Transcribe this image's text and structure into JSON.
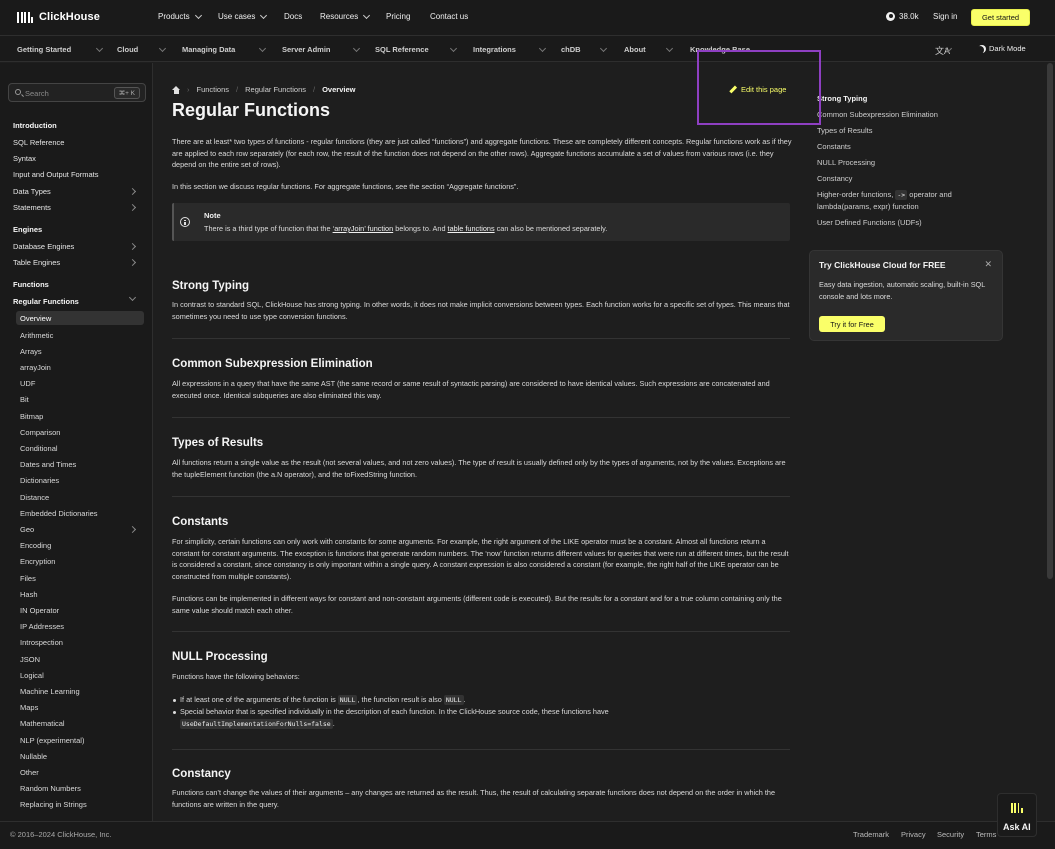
{
  "brand": {
    "name": "ClickHouse"
  },
  "topnav": {
    "items": [
      {
        "label": "Products",
        "dropdown": true
      },
      {
        "label": "Use cases",
        "dropdown": true
      },
      {
        "label": "Docs",
        "dropdown": false
      },
      {
        "label": "Resources",
        "dropdown": true
      },
      {
        "label": "Pricing",
        "dropdown": false
      },
      {
        "label": "Contact us",
        "dropdown": false
      }
    ],
    "github_stars": "38.0k",
    "signin": "Sign in",
    "get_started": "Get started"
  },
  "secnav": {
    "items": [
      "Getting Started",
      "Cloud",
      "Managing Data",
      "Server Admin",
      "SQL Reference",
      "Integrations",
      "chDB",
      "About",
      "Knowledge Base"
    ],
    "lang_icon": "文A",
    "dark_mode": "Dark Mode"
  },
  "sidebar": {
    "search_placeholder": "Search",
    "search_shortcut": "⌘+ K",
    "items": [
      {
        "label": "Introduction",
        "type": "head"
      },
      {
        "label": "SQL Reference",
        "type": "item"
      },
      {
        "label": "Syntax",
        "type": "item"
      },
      {
        "label": "Input and Output Formats",
        "type": "item"
      },
      {
        "label": "Data Types",
        "type": "item",
        "chevron": true
      },
      {
        "label": "Statements",
        "type": "item",
        "chevron": true
      },
      {
        "label": "Engines",
        "type": "head"
      },
      {
        "label": "Database Engines",
        "type": "item",
        "chevron": true
      },
      {
        "label": "Table Engines",
        "type": "item",
        "chevron": true
      },
      {
        "label": "Functions",
        "type": "head"
      },
      {
        "label": "Regular Functions",
        "type": "head",
        "expanded": true
      },
      {
        "label": "Overview",
        "type": "sub",
        "active": true
      },
      {
        "label": "Arithmetic",
        "type": "sub"
      },
      {
        "label": "Arrays",
        "type": "sub"
      },
      {
        "label": "arrayJoin",
        "type": "sub"
      },
      {
        "label": "UDF",
        "type": "sub"
      },
      {
        "label": "Bit",
        "type": "sub"
      },
      {
        "label": "Bitmap",
        "type": "sub"
      },
      {
        "label": "Comparison",
        "type": "sub"
      },
      {
        "label": "Conditional",
        "type": "sub"
      },
      {
        "label": "Dates and Times",
        "type": "sub"
      },
      {
        "label": "Dictionaries",
        "type": "sub"
      },
      {
        "label": "Distance",
        "type": "sub"
      },
      {
        "label": "Embedded Dictionaries",
        "type": "sub"
      },
      {
        "label": "Geo",
        "type": "sub",
        "chevron": true
      },
      {
        "label": "Encoding",
        "type": "sub"
      },
      {
        "label": "Encryption",
        "type": "sub"
      },
      {
        "label": "Files",
        "type": "sub"
      },
      {
        "label": "Hash",
        "type": "sub"
      },
      {
        "label": "IN Operator",
        "type": "sub"
      },
      {
        "label": "IP Addresses",
        "type": "sub"
      },
      {
        "label": "Introspection",
        "type": "sub"
      },
      {
        "label": "JSON",
        "type": "sub"
      },
      {
        "label": "Logical",
        "type": "sub"
      },
      {
        "label": "Machine Learning",
        "type": "sub"
      },
      {
        "label": "Maps",
        "type": "sub"
      },
      {
        "label": "Mathematical",
        "type": "sub"
      },
      {
        "label": "NLP (experimental)",
        "type": "sub"
      },
      {
        "label": "Nullable",
        "type": "sub"
      },
      {
        "label": "Other",
        "type": "sub"
      },
      {
        "label": "Random Numbers",
        "type": "sub"
      },
      {
        "label": "Replacing in Strings",
        "type": "sub"
      }
    ]
  },
  "breadcrumb": [
    "Functions",
    "Regular Functions",
    "Overview"
  ],
  "edit_link": "Edit this page",
  "page": {
    "title": "Regular Functions",
    "intro": "There are at least* two types of functions - regular functions (they are just called “functions”) and aggregate functions. These are completely different concepts. Regular functions work as if they are applied to each row separately (for each row, the result of the function does not depend on the other rows). Aggregate functions accumulate a set of values from various rows (i.e. they depend on the entire set of rows).",
    "intro2": "In this section we discuss regular functions. For aggregate functions, see the section “Aggregate functions”.",
    "note": {
      "title": "Note",
      "text_a": "There is a third type of function that the ",
      "link_a": "‘arrayJoin’ function",
      "text_b": " belongs to. And ",
      "link_b": "table functions",
      "text_c": " can also be mentioned separately."
    },
    "sections": {
      "strong_typing": {
        "title": "Strong Typing",
        "text": "In contrast to standard SQL, ClickHouse has strong typing. In other words, it does not make implicit conversions between types. Each function works for a specific set of types. This means that sometimes you need to use type conversion functions."
      },
      "cse": {
        "title": "Common Subexpression Elimination",
        "text": "All expressions in a query that have the same AST (the same record or same result of syntactic parsing) are considered to have identical values. Such expressions are concatenated and executed once. Identical subqueries are also eliminated this way."
      },
      "types_of_results": {
        "title": "Types of Results",
        "text": "All functions return a single value as the result (not several values, and not zero values). The type of result is usually defined only by the types of arguments, not by the values. Exceptions are the tupleElement function (the a.N operator), and the toFixedString function."
      },
      "constants": {
        "title": "Constants",
        "text": "For simplicity, certain functions can only work with constants for some arguments. For example, the right argument of the LIKE operator must be a constant. Almost all functions return a constant for constant arguments. The exception is functions that generate random numbers. The ‘now’ function returns different values for queries that were run at different times, but the result is considered a constant, since constancy is only important within a single query. A constant expression is also considered a constant (for example, the right half of the LIKE operator can be constructed from multiple constants).",
        "text2": "Functions can be implemented in different ways for constant and non-constant arguments (different code is executed). But the results for a constant and for a true column containing only the same value should match each other."
      },
      "null_processing": {
        "title": "NULL Processing",
        "text": "Functions have the following behaviors:",
        "b1_a": "If at least one of the arguments of the function is ",
        "b1_code": "NULL",
        "b1_b": ", the function result is also ",
        "b1_code2": "NULL",
        "b1_c": ".",
        "b2_a": "Special behavior that is specified individually in the description of each function. In the ClickHouse source code, these functions have",
        "b2_code": "UseDefaultImplementationForNulls=false",
        "b2_b": "."
      },
      "constancy": {
        "title": "Constancy",
        "text": "Functions can’t change the values of their arguments – any changes are returned as the result. Thus, the result of calculating separate functions does not depend on the order in which the functions are written in the query."
      }
    }
  },
  "toc": {
    "items": [
      {
        "label": "Strong Typing",
        "active": true
      },
      {
        "label": "Common Subexpression Elimination"
      },
      {
        "label": "Types of Results"
      },
      {
        "label": "Constants"
      },
      {
        "label": "NULL Processing"
      },
      {
        "label": "Constancy"
      }
    ],
    "higher_order_a": "Higher-order functions, ",
    "higher_order_code": "->",
    "higher_order_b": " operator and",
    "higher_order_c": "lambda(params, expr) function",
    "udf": "User Defined Functions (UDFs)"
  },
  "cloud_card": {
    "title": "Try ClickHouse Cloud for FREE",
    "close": "✕",
    "text": "Easy data ingestion, automatic scaling, built-in SQL console and lots more.",
    "button": "Try it for Free"
  },
  "footer": {
    "copyright": "© 2016–2024 ClickHouse, Inc.",
    "links": [
      "Trademark",
      "Privacy",
      "Security",
      "Terms"
    ]
  },
  "ask_ai": "Ask AI",
  "colors": {
    "accent": "#faff69",
    "background": "#1e1e1e",
    "highlight": "#8e3fc2"
  }
}
